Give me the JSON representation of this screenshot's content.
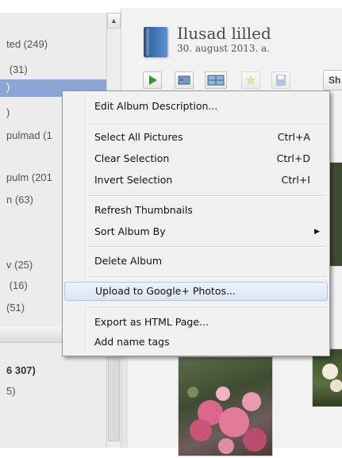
{
  "sidebar": {
    "upper_rows": [
      "ted (249)",
      " (31)",
      ")",
      ")",
      "pulmad (1",
      "",
      "pulm (201",
      "n (63)",
      "",
      "",
      "v (25)",
      " (16)",
      "(51)"
    ],
    "lower_rows": [
      "6 307)",
      "5)"
    ]
  },
  "album": {
    "title": "Ilusad lilled",
    "date": "30. august 2013. a."
  },
  "toolbar": {
    "share_label": "Sh",
    "buttons": [
      "play-icon",
      "slideshow-icon",
      "collage-icon",
      "star-icon",
      "save-icon"
    ]
  },
  "context_menu": {
    "items": [
      {
        "label": "Edit Album Description...",
        "shortcut": ""
      },
      {
        "label": "Select All Pictures",
        "shortcut": "Ctrl+A"
      },
      {
        "label": "Clear Selection",
        "shortcut": "Ctrl+D"
      },
      {
        "label": "Invert Selection",
        "shortcut": "Ctrl+I"
      },
      {
        "label": "Refresh Thumbnails",
        "shortcut": ""
      },
      {
        "label": "Sort Album By",
        "shortcut": ""
      },
      {
        "label": "Delete Album",
        "shortcut": ""
      },
      {
        "label": "Upload to Google+ Photos...",
        "shortcut": ""
      },
      {
        "label": "Export as HTML Page...",
        "shortcut": ""
      },
      {
        "label": "Add name tags",
        "shortcut": ""
      }
    ],
    "highlighted_item": "Upload to Google+ Photos..."
  },
  "colors": {
    "selection": "#8aa6d6",
    "menu_highlight": "#dbe6f6",
    "album_icon": "#3d6fae"
  }
}
